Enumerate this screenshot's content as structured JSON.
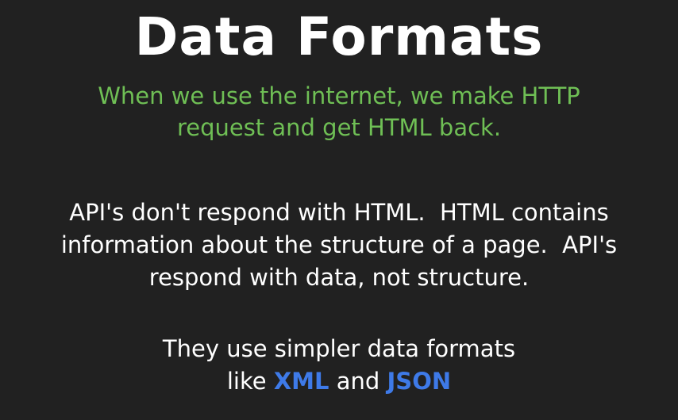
{
  "slide": {
    "title": "Data Formats",
    "subtitle_lines": [
      "When we use the internet, we make HTTP",
      "request and get HTML back."
    ],
    "paragraph_lines": [
      "API's don't respond with HTML.  HTML contains",
      "information about the structure of a page.  API's",
      "respond with data, not structure."
    ],
    "closing": {
      "line1": "They use simpler data formats",
      "line2_prefix": "like ",
      "format1": "XML",
      "conjunction": " and ",
      "format2": "JSON"
    },
    "colors": {
      "background": "#212121",
      "subtitle": "#6fbf55",
      "highlight": "#3e7ae8",
      "text": "#ffffff"
    }
  }
}
